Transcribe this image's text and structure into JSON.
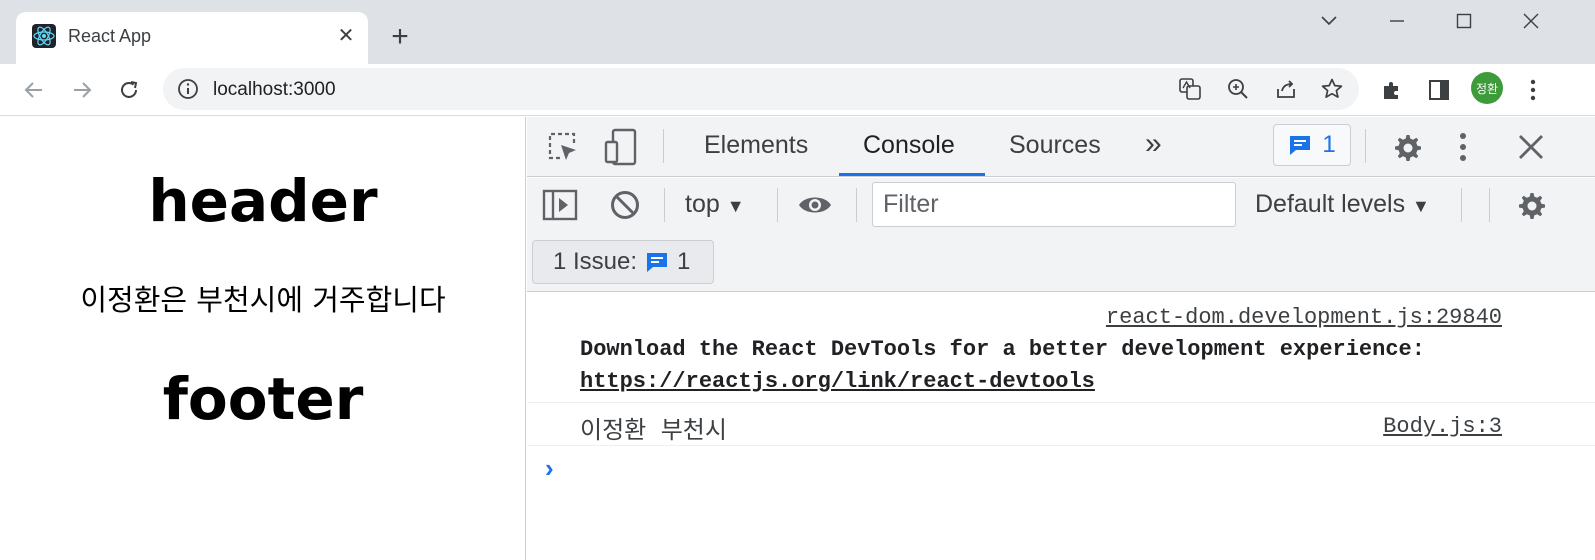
{
  "browser": {
    "tab": {
      "title": "React App",
      "close_glyph": "✕"
    },
    "new_tab_glyph": "+",
    "omnibox": {
      "url": "localhost:3000"
    },
    "profile_initials": "정환"
  },
  "page": {
    "header": "header",
    "body_text": "이정환은 부천시에 거주합니다",
    "footer": "footer"
  },
  "devtools": {
    "tabs": [
      "Elements",
      "Console",
      "Sources"
    ],
    "active_tab": "Console",
    "more_tabs_glyph": "»",
    "issues_badge_count": "1",
    "context": "top",
    "filter_placeholder": "Filter",
    "levels": "Default levels",
    "issues_button": {
      "label": "1 Issue:",
      "count": "1"
    },
    "console": {
      "messages": [
        {
          "source": "react-dom.development.js:29840",
          "text": "Download the React DevTools for a better development experience:",
          "link": "https://reactjs.org/link/react-devtools"
        },
        {
          "source": "Body.js:3",
          "text": "이정환 부천시"
        }
      ],
      "prompt_glyph": "›"
    }
  },
  "colors": {
    "accent": "#1a73e8",
    "tabstrip": "#dee1e6",
    "avatar": "#3e9b3a"
  }
}
